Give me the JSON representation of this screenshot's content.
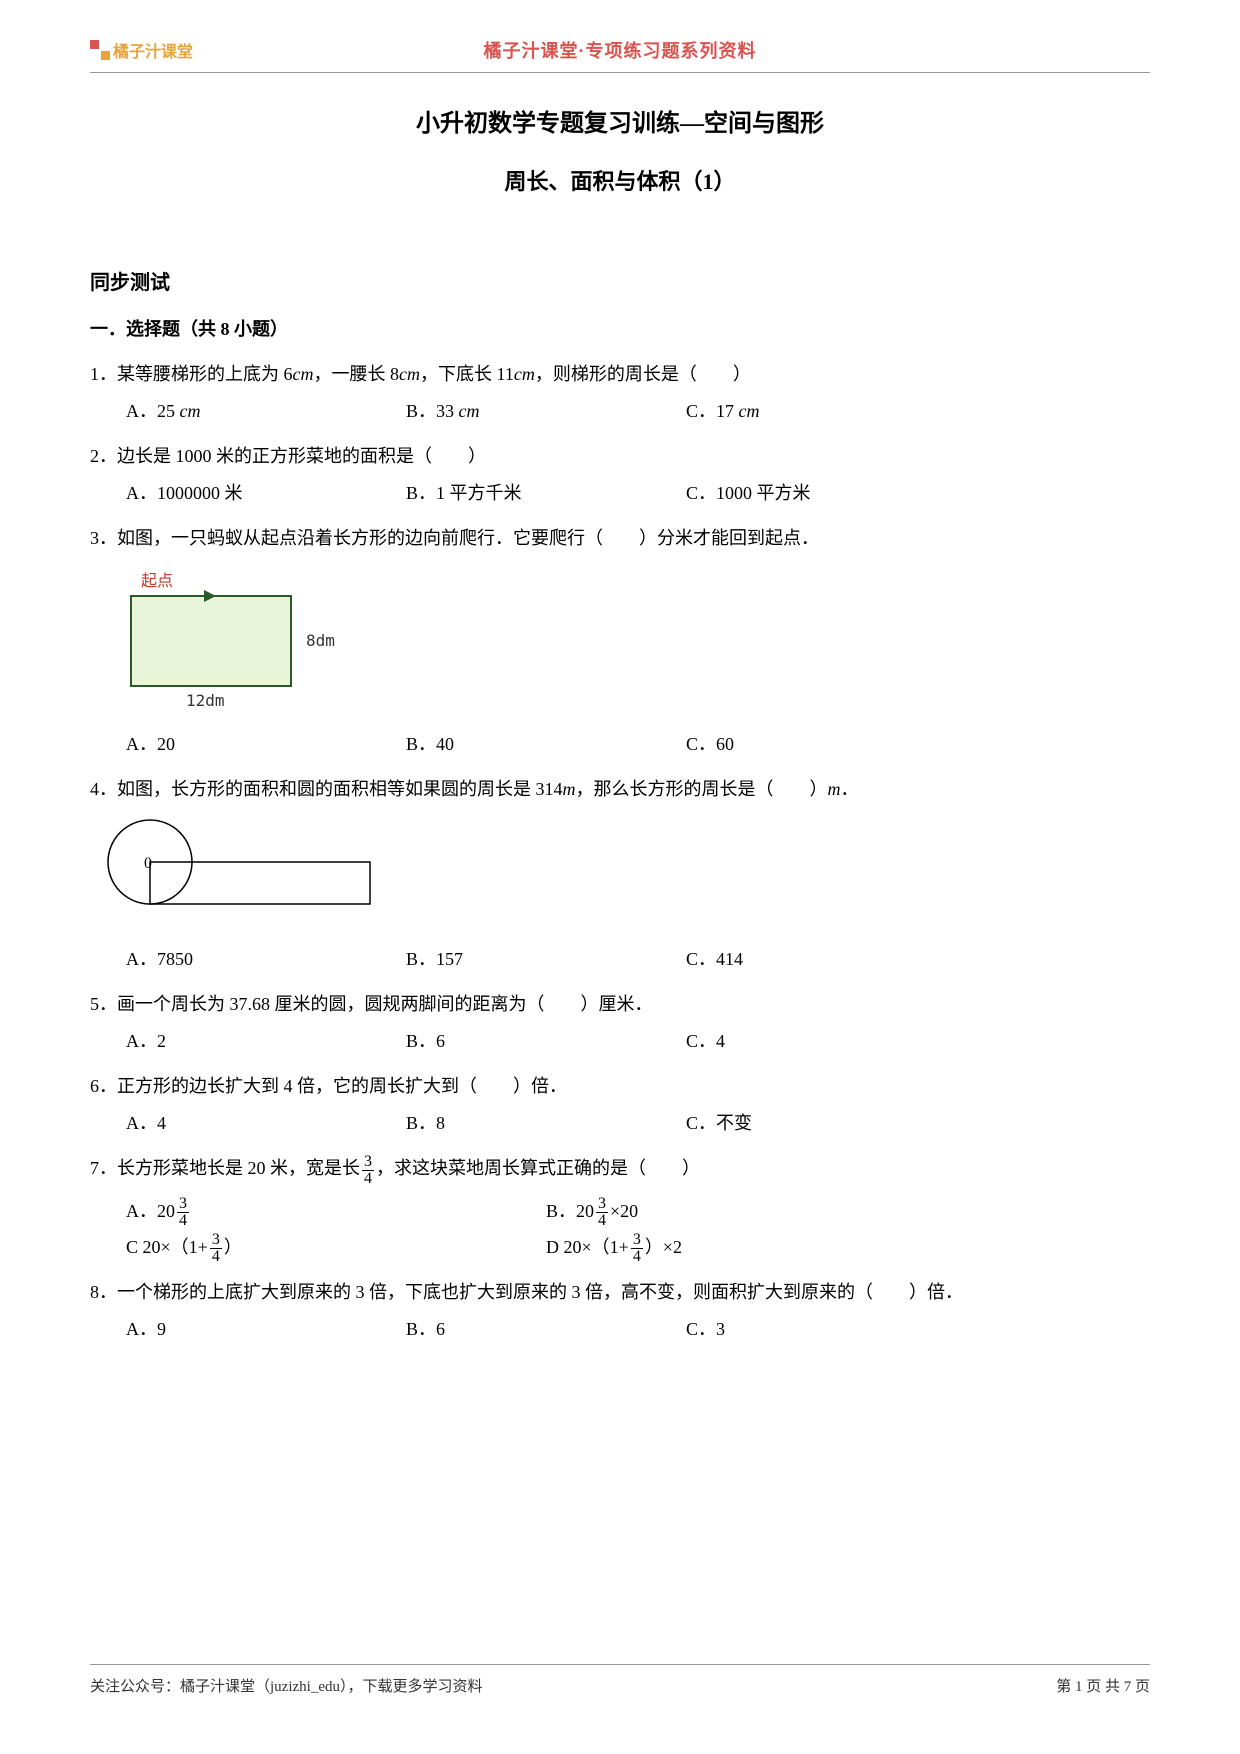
{
  "header": {
    "logo_text": "橘子汁课堂",
    "center": "橘子汁课堂·专项练习题系列资料"
  },
  "titles": {
    "main": "小升初数学专题复习训练—空间与图形",
    "sub": "周长、面积与体积（1）"
  },
  "section_sync": "同步测试",
  "part1_title": "一．选择题（共 8 小题）",
  "q1": {
    "text_a": "1．某等腰梯形的上底为 6",
    "unit1": "cm",
    "text_b": "，一腰长 8",
    "unit2": "cm",
    "text_c": "，下底长 11",
    "unit3": "cm",
    "text_d": "，则梯形的周长是（　　）",
    "A_label": "A．25 ",
    "A_unit": "cm",
    "B_label": "B．33 ",
    "B_unit": "cm",
    "C_label": "C．17 ",
    "C_unit": "cm"
  },
  "q2": {
    "text": "2．边长是 1000 米的正方形菜地的面积是（　　）",
    "A": "A．1000000 米",
    "B": "B．1 平方千米",
    "C": "C．1000 平方米"
  },
  "q3": {
    "text": "3．如图，一只蚂蚁从起点沿着长方形的边向前爬行．它要爬行（　　）分米才能回到起点．",
    "start_label": "起点",
    "h_label": "8dm",
    "w_label": "12dm",
    "A": "A．20",
    "B": "B．40",
    "C": "C．60"
  },
  "q4": {
    "text_a": "4．如图，长方形的面积和圆的面积相等如果圆的周长是 314",
    "unit1": "m",
    "text_b": "，那么长方形的周长是（　　）",
    "unit2": "m",
    "text_c": "．",
    "circle_label": "0",
    "A": "A．7850",
    "B": "B．157",
    "C": "C．414"
  },
  "q5": {
    "text": "5．画一个周长为 37.68 厘米的圆，圆规两脚间的距离为（　　）厘米．",
    "A": "A．2",
    "B": "B．6",
    "C": "C．4"
  },
  "q6": {
    "text": "6．正方形的边长扩大到 4 倍，它的周长扩大到（　　）倍．",
    "A": "A．4",
    "B": "B．8",
    "C": "C．不变"
  },
  "q7": {
    "text_a": "7．长方形菜地长是 20 米，宽是长",
    "frac_n": "3",
    "frac_d": "4",
    "text_b": "，求这块菜地周长算式正确的是（　　）",
    "A_pre": "A．20",
    "A_n": "3",
    "A_d": "4",
    "B_pre": "B．20",
    "B_n": "3",
    "B_d": "4",
    "B_post": "×20",
    "C_pre": "C 20×（1+",
    "C_n": "3",
    "C_d": "4",
    "C_post": "）",
    "D_pre": "D 20×（1+",
    "D_n": "3",
    "D_d": "4",
    "D_post": "）×2"
  },
  "q8": {
    "text": "8．一个梯形的上底扩大到原来的 3 倍，下底也扩大到原来的 3 倍，高不变，则面积扩大到原来的（　　）倍．",
    "A": "A．9",
    "B": "B．6",
    "C": "C．3"
  },
  "footer": {
    "left": "关注公众号：橘子汁课堂（juzizhi_edu），下载更多学习资料",
    "right": "第 1 页 共 7 页"
  }
}
